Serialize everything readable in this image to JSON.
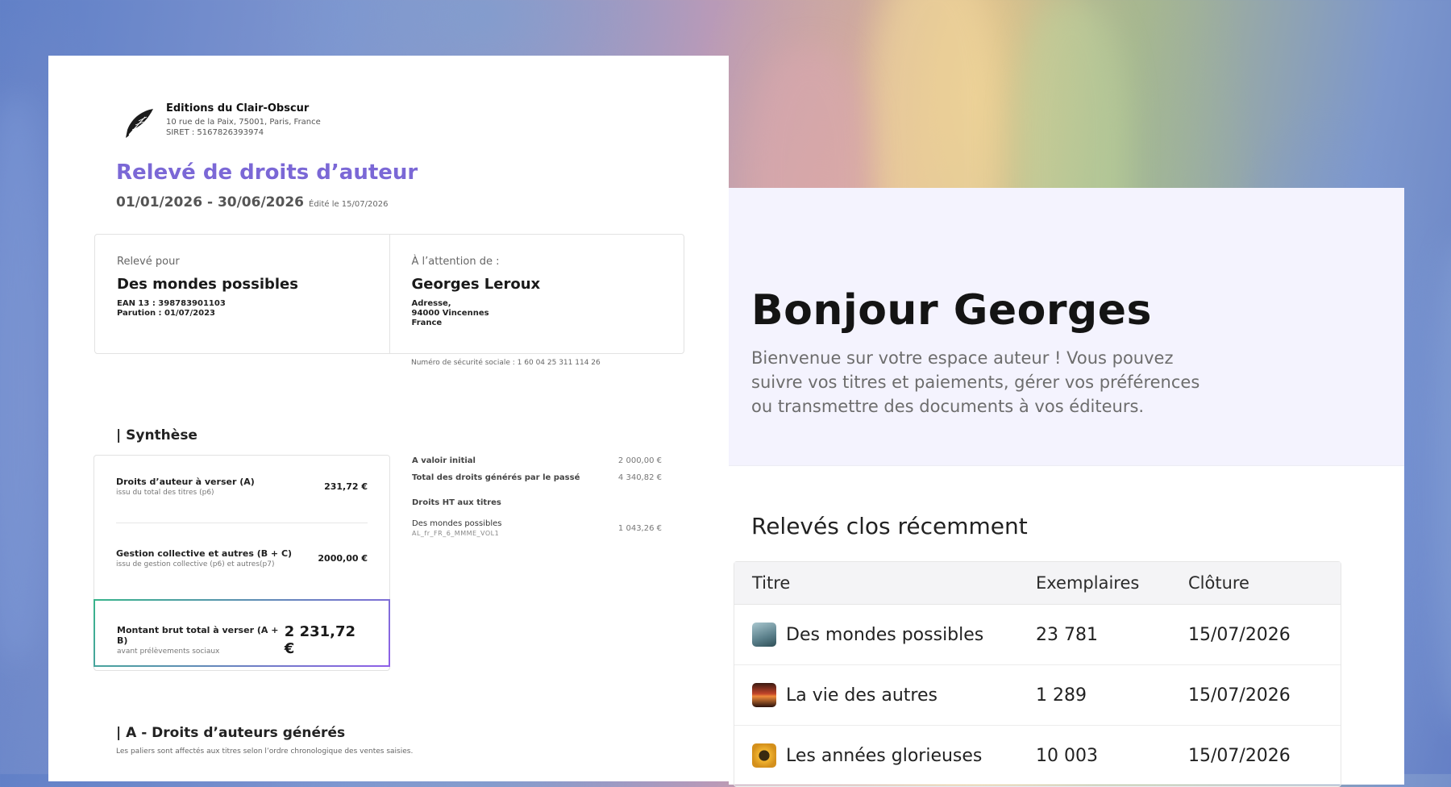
{
  "statement": {
    "publisher": {
      "name": "Editions du Clair-Obscur",
      "address": "10 rue de la Paix, 75001, Paris, France",
      "siret": "SIRET : 5167826393974"
    },
    "title": "Relevé de droits d’auteur",
    "period": "01/01/2026 - 30/06/2026",
    "edited": "Édité le 15/07/2026",
    "for": {
      "label": "Relevé pour",
      "book": "Des mondes possibles",
      "meta": "EAN 13 : 398783901103\nParution : 01/07/2023"
    },
    "attention": {
      "label": "À l’attention de :",
      "name": "Georges Leroux",
      "address": "Adresse,\n94000 Vincennes\nFrance"
    },
    "ssn": "Numéro de sécurité sociale : 1 60 04 25 311 114 26",
    "synthesis_title": "| Synthèse",
    "synthesis": {
      "a": {
        "title": "Droits d’auteur à verser (A)",
        "sub": "issu du total des titres (p6)",
        "value": "231,72 €"
      },
      "bc": {
        "title": "Gestion collective et autres (B + C)",
        "sub": "issu de gestion collective (p6) et autres(p7)",
        "value": "2000,00 €"
      },
      "total": {
        "title": "Montant brut total à verser (A + B)",
        "sub": "avant prélèvements sociaux",
        "value": "2 231,72 €"
      }
    },
    "details": {
      "initial_label": "A valoir initial",
      "initial_value": "2 000,00 €",
      "past_label": "Total des droits générés par le passé",
      "past_value": "4 340,82 €",
      "ht_label": "Droits HT aux titres",
      "book_label": "Des mondes possibles",
      "book_code": "AL_fr_FR_6_MMME_VOL1",
      "book_value": "1 043,26 €"
    },
    "section_a_title": "| A - Droits d’auteurs générés",
    "section_a_note": "Les paliers sont affectés aux titres selon l’ordre chronologique des ventes saisies."
  },
  "dashboard": {
    "greeting": "Bonjour Georges",
    "intro": "Bienvenue sur votre espace auteur ! Vous pouvez suivre vos titres et paiements, gérer vos préférences ou transmettre des documents à vos éditeurs.",
    "recent_title": "Relevés clos récemment",
    "columns": [
      "Titre",
      "Exemplaires",
      "Clôture"
    ],
    "rows": [
      {
        "title": "Des mondes possibles",
        "copies": "23 781",
        "closing": "15/07/2026",
        "icon": "cover-thumbnail-icon",
        "color": "#6d8f9a"
      },
      {
        "title": "La vie des autres",
        "copies": "1 289",
        "closing": "15/07/2026",
        "icon": "cover-thumbnail-icon",
        "color": "#b0402a"
      },
      {
        "title": "Les années glorieuses",
        "copies": "10 003",
        "closing": "15/07/2026",
        "icon": "cover-thumbnail-icon",
        "color": "#e0a528"
      }
    ]
  }
}
